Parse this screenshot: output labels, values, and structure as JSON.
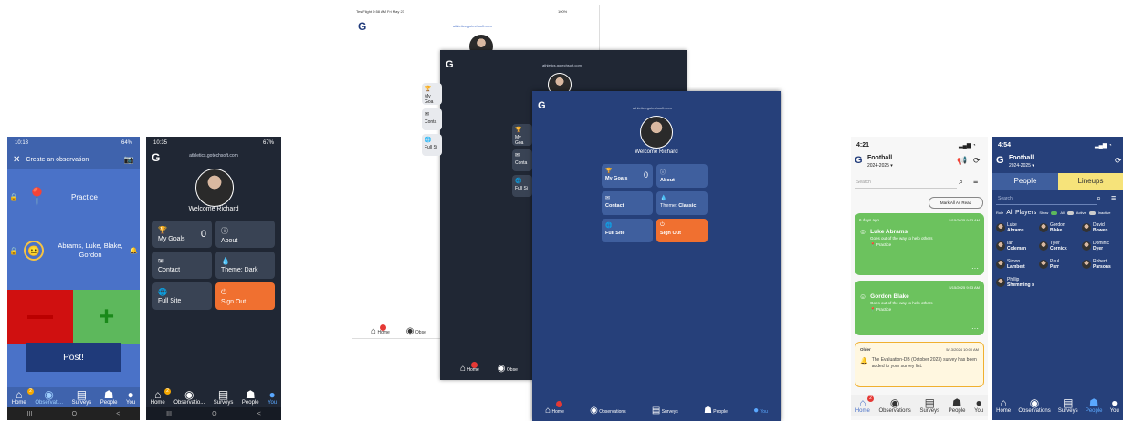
{
  "s1": {
    "time": "10:13",
    "battery": "64%",
    "title": "Create an observation",
    "practice": "Practice",
    "people": "Abrams, Luke, Blake, Gordon",
    "post": "Post!",
    "tabs": [
      "Home",
      "Observati...",
      "Surveys",
      "People",
      "You"
    ],
    "badge": "2",
    "nav": [
      "III",
      "O",
      "<"
    ]
  },
  "s2": {
    "time": "10:35",
    "battery": "67%",
    "email": "athletics.gotechsoft.com",
    "welcome": "Welcome Richard",
    "goals": "My Goals",
    "goals_count": "0",
    "about": "About",
    "contact": "Contact",
    "theme": "Theme: Dark",
    "full_site": "Full Site",
    "sign_out": "Sign Out",
    "tabs": [
      "Home",
      "Observatio...",
      "Surveys",
      "People",
      "You"
    ],
    "badge": "2",
    "nav": [
      "III",
      "O",
      "<"
    ]
  },
  "ipad": {
    "status_left": "TestFlight 9:58 AM Fri May 23",
    "status_right": "100%",
    "email_white": "athletics.gotechsoft.com",
    "email_dark": "athletics.gotechsoft.com",
    "email_blue": "athletics.gotechsoft.com",
    "welcome": "Welcome Richard",
    "goals": "My Goals",
    "goals_count": "0",
    "about": "About",
    "contact": "Contact",
    "theme_label": "Theme:",
    "theme_value": "Classic",
    "full_site": "Full Site",
    "sign_out": "Sign Out",
    "peek_goals": "My Goa",
    "peek_contact": "Conta",
    "peek_full": "Full Si",
    "tabs_white": [
      "Home",
      "Obse"
    ],
    "tabs_dark": [
      "Home",
      "Obse"
    ],
    "tabs_blue": [
      "Home",
      "Observations",
      "Surveys",
      "People",
      "You"
    ]
  },
  "s5": {
    "time": "4:21",
    "team": "Football",
    "season": "2024-2025 ▾",
    "search_placeholder": "Search",
    "mark_all": "Mark All As Read",
    "section1": "6 days ago",
    "cards": [
      {
        "name": "Luke Abrams",
        "text": "Goes out of the way to help others",
        "tag": "Practice",
        "date": "5/15/2025 9:53 AM"
      },
      {
        "name": "Gordon Blake",
        "text": "Goes out of the way to help others",
        "tag": "Practice",
        "date": "5/15/2025 9:53 AM"
      }
    ],
    "section2": "Older",
    "survey_date": "5/13/2024 10:00 AM",
    "survey_text": "The Evaluation-DB (October 2023) survey has been added to your survey list.",
    "tabs": [
      "Home",
      "Observations",
      "Surveys",
      "People",
      "You"
    ],
    "badge": "2"
  },
  "s6": {
    "time": "4:54",
    "team": "Football",
    "season": "2024-2025 ▾",
    "tab_people": "People",
    "tab_lineups": "Lineups",
    "search_placeholder": "Search",
    "role": "Role",
    "all_players": "All Players",
    "show": "Show",
    "all": "All",
    "active": "Active",
    "inactive": "Inactive",
    "players": [
      [
        "Luke",
        "Abrams"
      ],
      [
        "Gordon",
        "Blake"
      ],
      [
        "David",
        "Bowen"
      ],
      [
        "Ian",
        "Coleman"
      ],
      [
        "Tyler",
        "Cornick"
      ],
      [
        "Dominic",
        "Dyer"
      ],
      [
        "Simon",
        "Lambert"
      ],
      [
        "Paul",
        "Parr"
      ],
      [
        "Robert",
        "Parsons"
      ],
      [
        "Phillip",
        "Shemming s"
      ]
    ],
    "tabs": [
      "Home",
      "Observations",
      "Surveys",
      "People",
      "You"
    ]
  }
}
